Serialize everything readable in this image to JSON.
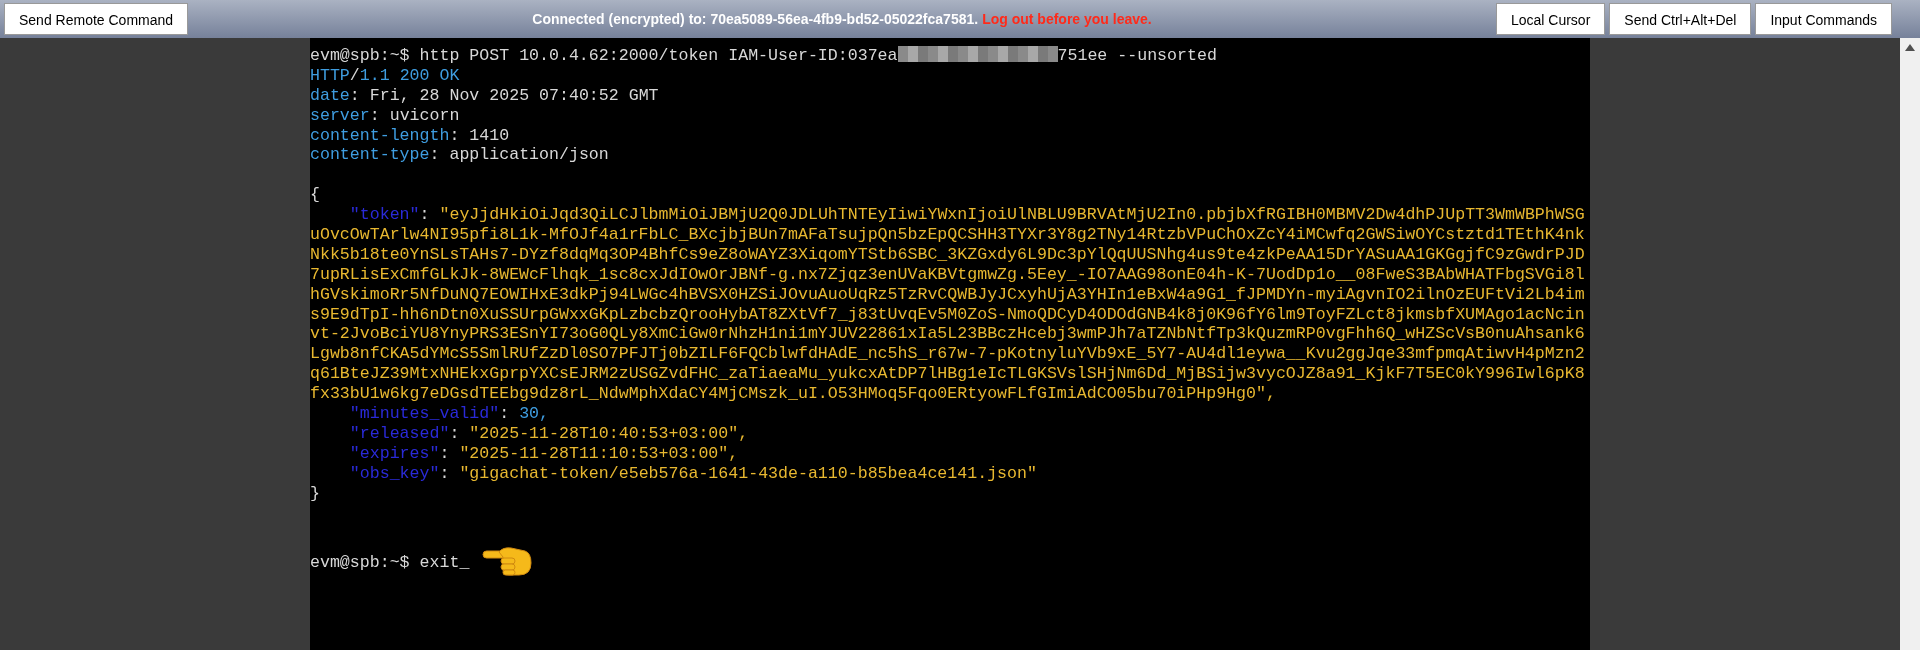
{
  "toolbar": {
    "left_buttons": [
      "Send Remote Command"
    ],
    "status_text": "Connected (encrypted) to: 70ea5089-56ea-4fb9-bd52-05022fca7581.",
    "warning_text": "Log out before you leave.",
    "right_buttons": [
      "Local Cursor",
      "Send Ctrl+Alt+Del",
      "Input Commands"
    ]
  },
  "terminal": {
    "prompt": "evm@spb:~$",
    "command_start": "http POST 10.0.4.62:2000/token IAM-User-ID:037ea",
    "command_end": "751ee --unsorted",
    "status_line": {
      "protocol": "HTTP",
      "slash": "/",
      "rest": "1.1 200 OK"
    },
    "headers": [
      {
        "name": "date",
        "separator": ":",
        "value": "Fri, 28 Nov 2025 07:40:52 GMT"
      },
      {
        "name": "server",
        "separator": ":",
        "value": "uvicorn"
      },
      {
        "name": "content-length",
        "separator": ":",
        "value": "1410"
      },
      {
        "name": "content-type",
        "separator": ":",
        "value": "application/json"
      }
    ],
    "open_brace": "{",
    "token_key": "\"token\"",
    "token_separator": ":",
    "token_lines": [
      "\"eyJjdHkiOiJqd3QiLCJlbmMiOiJBMjU2Q0JDLUhTNTEyIiwiYWxnIjoiUlNBLU9BRVAtMjU2In0.pbjbXfRGIBH0MBMV2Dw4dhPJUpTT3WmWBPhWSG",
      "uOvcOwTArlw4NI95pfi8L1k-MfOJf4a1rFbLC_BXcjbjBUn7mAFaTsujpQn5bzEpQCSHH3TYXr3Y8g2TNy14RtzbVPuChOxZcY4iMCwfq2GWSiwOYCstztd1TEthK4nk",
      "Nkk5b18te0YnSLsTAHs7-DYzf8dqMq3OP4BhfCs9eZ8oWAYZ3XiqomYTStb6SBC_3KZGxdy6L9Dc3pYlQqUUSNhg4us9te4zkPeAA15DrYASuAA1GKGgjfC9zGwdrPJD",
      "7upRLisExCmfGLkJk-8WEWcFlhqk_1sc8cxJdIOwOrJBNf-g.nx7Zjqz3enUVaKBVtgmwZg.5Eey_-IO7AAG98onE04h-K-7UodDp1o__08FweS3BAbWHATFbgSVGi8l",
      "hGVskimoRr5NfDuNQ7EOWIHxE3dkPj94LWGc4hBVSX0HZSiJOvuAuoUqRz5TzRvCQWBJyJCxyhUjA3YHIn1eBxW4a9G1_fJPMDYn-myiAgvnIO2ilnOzEUFtVi2Lb4im",
      "s9E9dTpI-hh6nDtn0XuSSUrpGWxxGKpLzbcbzQrooHybAT8ZXtVf7_j83tUvqEv5M0ZoS-NmoQDCyD4ODOdGNB4k8j0K96fY6lm9ToyFZLct8jkmsbfXUMAgo1acNcin",
      "vt-2JvoBciYU8YnyPRS3ESnYI73oG0QLy8XmCiGw0rNhzH1ni1mYJUV22861xIa5L23BBczHcebj3wmPJh7aTZNbNtfTp3kQuzmRP0vgFhh6Q_wHZScVsB0nuAhsank6",
      "Lgwb8nfCKA5dYMcS5SmlRUfZzDl0SO7PFJTj0bZILF6FQCblwfdHAdE_nc5hS_r67w-7-pKotnyluYVb9xE_5Y7-AU4dl1eywa__Kvu2ggJqe33mfpmqAtiwvH4pMzn2",
      "q61BteJZ39MtxNHEkxGprpYXCsEJRM2zUSGZvdFHC_zaTiaeaMu_yukcxAtDP7lHBg1eIcTLGKSVslSHjNm6Dd_MjBSijw3vycOJZ8a91_KjkF7T5EC0kY996Iwl6pK8",
      "fx33bU1w6kg7eDGsdTEEbg9dz8rL_NdwMphXdaCY4MjCMszk_uI.O53HMoq5Fqo0ERtyowFLfGImiAdCO05bu70iPHp9Hg0\","
    ],
    "fields": [
      {
        "key": "\"minutes_valid\"",
        "separator": ":",
        "value": "30,",
        "kind": "number"
      },
      {
        "key": "\"released\"",
        "separator": ":",
        "value": "\"2025-11-28T10:40:53+03:00\",",
        "kind": "string"
      },
      {
        "key": "\"expires\"",
        "separator": ":",
        "value": "\"2025-11-28T11:10:53+03:00\",",
        "kind": "string"
      },
      {
        "key": "\"obs_key\"",
        "separator": ":",
        "value": "\"gigachat-token/e5eb576a-1641-43de-a110-b85bea4ce141.json\"",
        "kind": "string"
      }
    ],
    "close_brace": "}",
    "last_prompt": "evm@spb:~$",
    "last_command": "exit_"
  }
}
